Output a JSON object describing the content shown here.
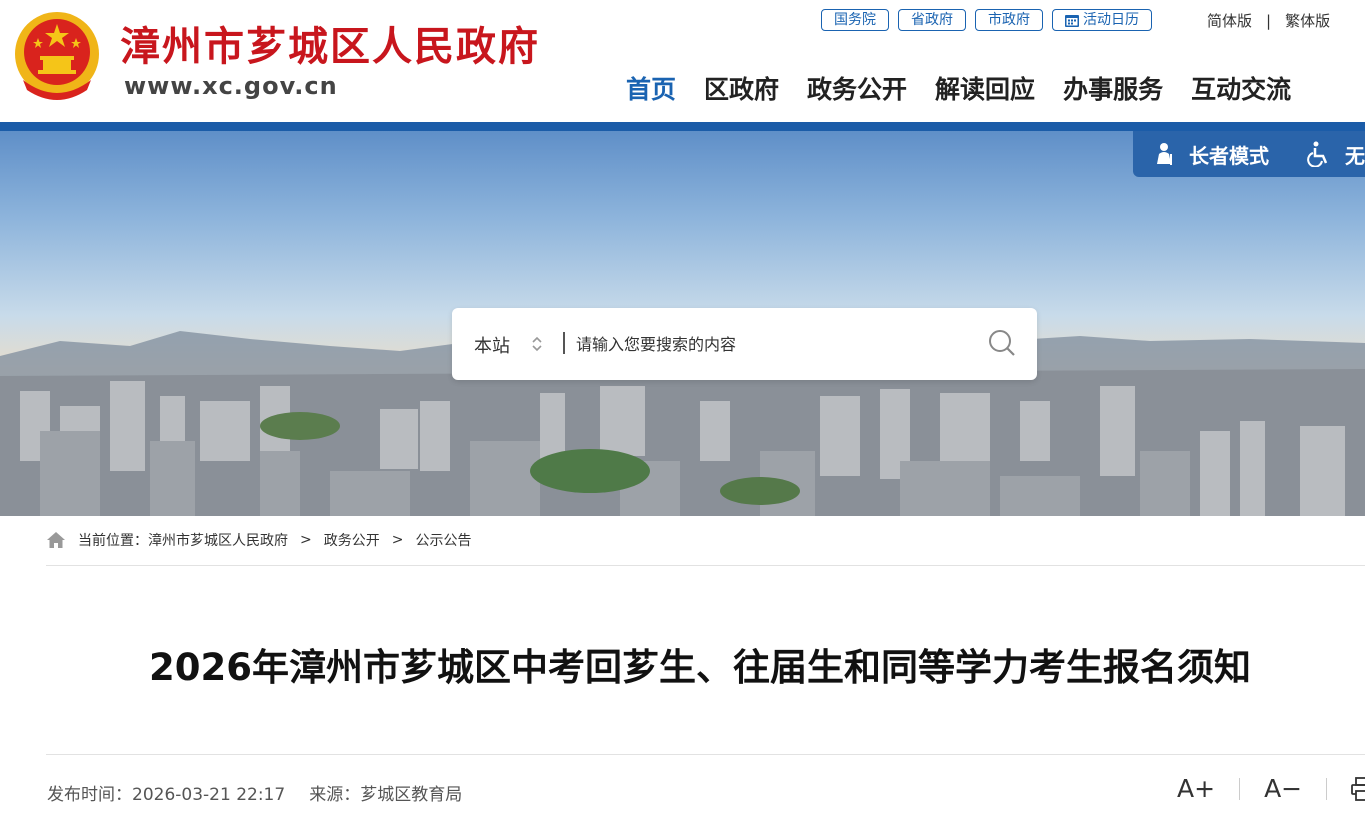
{
  "header": {
    "site_title": "漳州市芗城区人民政府",
    "site_url": "www.xc.gov.cn",
    "top_links": [
      "国务院",
      "省政府",
      "市政府"
    ],
    "calendar_label": "活动日历",
    "lang_simplified": "简体版",
    "lang_separator": "|",
    "lang_traditional": "繁体版",
    "nav": [
      "首页",
      "区政府",
      "政务公开",
      "解读回应",
      "办事服务",
      "互动交流"
    ],
    "nav_active": "首页"
  },
  "mode_bar": {
    "elder_mode": "长者模式",
    "accessible_mode": "无"
  },
  "search": {
    "scope": "本站",
    "placeholder": "请输入您要搜索的内容"
  },
  "breadcrumb": {
    "label": "当前位置：",
    "items": [
      "漳州市芗城区人民政府",
      "政务公开",
      "公示公告"
    ],
    "separator": ">"
  },
  "article": {
    "title": "2026年漳州市芗城区中考回芗生、往届生和同等学力考生报名须知",
    "publish_label": "发布时间：",
    "publish_time": "2026-03-21 22:17",
    "source_label": "来源：",
    "source": "芗城区教育局"
  },
  "tools": {
    "font_larger": "A+",
    "font_smaller": "A−"
  },
  "colors": {
    "brand_red": "#c8161d",
    "accent_blue": "#1a63b1",
    "bar_blue": "#1b5ca8"
  }
}
